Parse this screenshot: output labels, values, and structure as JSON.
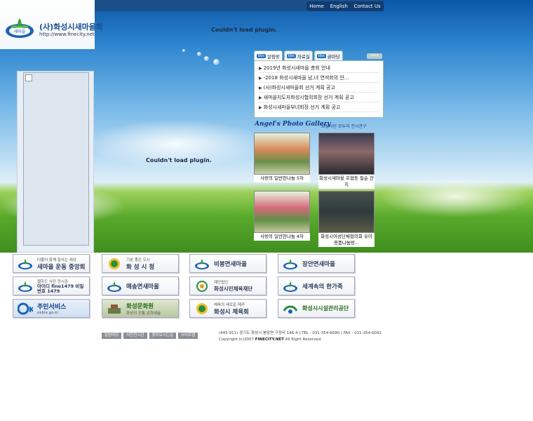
{
  "header": {
    "logo_title": "(사)화성시새마을회",
    "logo_url": "http://www.finecity.net"
  },
  "topnav": {
    "items": [
      "Home",
      "English",
      "Contact Us"
    ]
  },
  "plugins": {
    "header_plugin": "Couldn't load plugin.",
    "main_plugin": "Couldn't load plugin."
  },
  "notice": {
    "tabs": [
      "알림방",
      "자료실",
      "글마당"
    ],
    "more_label": "more",
    "items": [
      "2019년 화성시새마을 총회 안내",
      "-2018 화성시새마을 남,녀 연석회의 안...",
      "(사)화성시새마을회 선거 계획 공고",
      "새마을지도자화성시협의회장 선거 계획 공고",
      "화성시새마을부녀회장 선거 계획 공고"
    ]
  },
  "gallery": {
    "title": "Angel's Photo Gallery",
    "subtitle": "화성시민 모두의 전시관구",
    "items": [
      {
        "caption": "사랑의 일반찬나눔 5차"
      },
      {
        "caption": "화성시새마을 호협동 필순 잔치"
      },
      {
        "caption": "사랑의 일반찬나눔 4차"
      },
      {
        "caption": "화성시여성단체협의회 유아 용품나눔방..."
      }
    ]
  },
  "banners": [
    {
      "label": "새마을 운동 중앙회",
      "sub": "더불어 함께 잘사는 세상"
    },
    {
      "label": "화 성 시 청",
      "sub": "기분 좋은 도시"
    },
    {
      "label": "비봉면새마을",
      "sub": ""
    },
    {
      "label": "장안면새마을",
      "sub": ""
    },
    {
      "label": "아이디 fine1479  비밀번호 1479",
      "sub": "웹하드 사진 전시관"
    },
    {
      "label": "매송면새마을",
      "sub": ""
    },
    {
      "label": "화성시민체육재단",
      "sub": "재단법인"
    },
    {
      "label": "세계속의 한가족",
      "sub": ""
    },
    {
      "label": "주민서비스",
      "sub": "okble.go.kr"
    },
    {
      "label": "화성문화원",
      "sub": "화성의 전통 문화예술"
    },
    {
      "label": "화성시 체육회",
      "sub": "체육의 새로운 메카"
    },
    {
      "label": "화성시시설관리공단",
      "sub": ""
    }
  ],
  "footer": {
    "links": [
      "알림마당",
      "사진전시관",
      "찾아오시는길",
      "사이트맵"
    ],
    "address": "(445-911) 경기도 화성시 봉담면 구정리 146-4 | TEL : 031-354-6090 | FAX : 031-354-6092",
    "copyright_prefix": "Copyright (c)2007",
    "copyright_brand": "FINECITY.NET",
    "copyright_suffix": "All Right Reserved."
  },
  "colors": {
    "brand_blue": "#184f93",
    "nav_bg": "#0f3c72",
    "tab_badge": "#2a6fb8"
  }
}
